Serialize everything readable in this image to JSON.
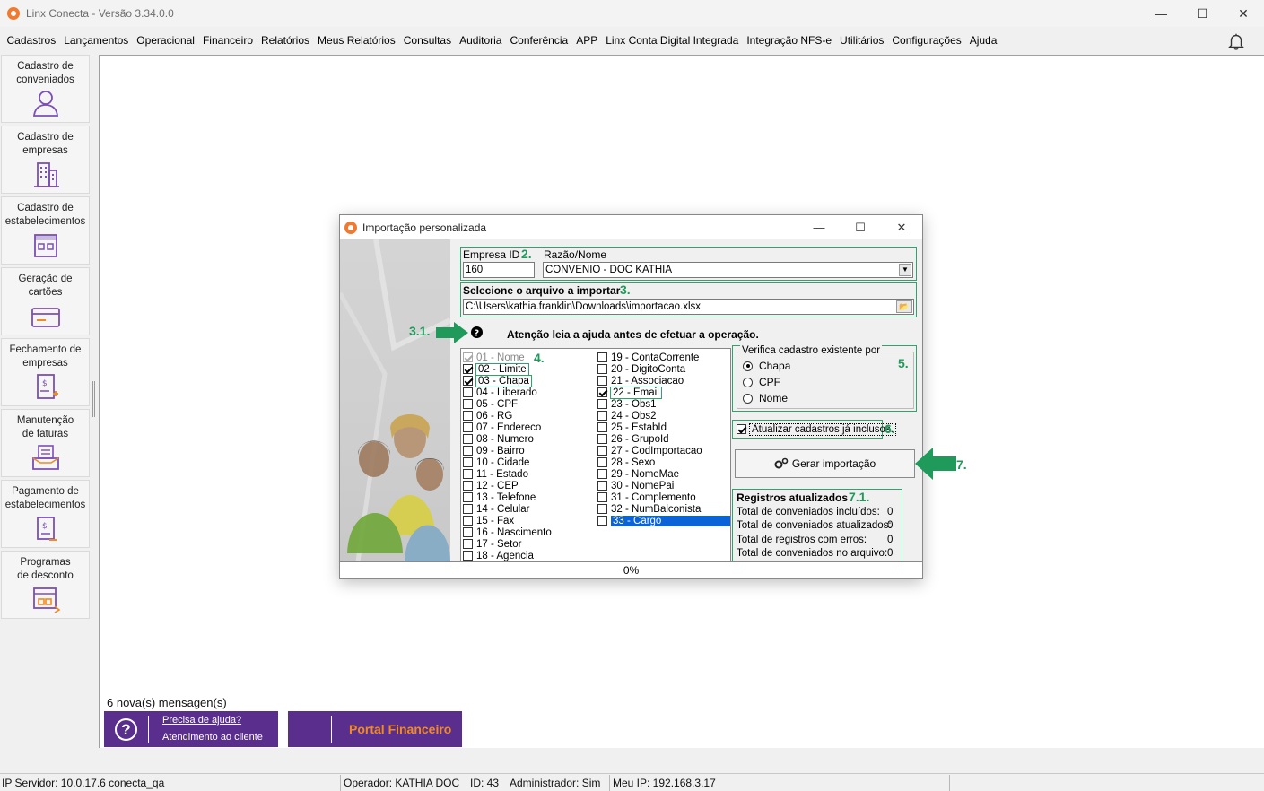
{
  "app": {
    "title": "Linx Conecta - Versão 3.34.0.0"
  },
  "window_controls": {
    "minimize": "—",
    "maximize": "☐",
    "close": "✕"
  },
  "menu": [
    "Cadastros",
    "Lançamentos",
    "Operacional",
    "Financeiro",
    "Relatórios",
    "Meus Relatórios",
    "Consultas",
    "Auditoria",
    "Conferência",
    "APP",
    "Linx Conta Digital Integrada",
    "Integração NFS-e",
    "Utilitários",
    "Configurações",
    "Ajuda"
  ],
  "sidebar": [
    {
      "label": "Cadastro de conveniados",
      "icon": "person-icon"
    },
    {
      "label": "Cadastro de empresas",
      "icon": "building-icon"
    },
    {
      "label": "Cadastro de estabelecimentos",
      "icon": "store-icon"
    },
    {
      "label": "Geração de cartões",
      "icon": "card-icon"
    },
    {
      "label": "Fechamento de empresas",
      "icon": "invoice-icon"
    },
    {
      "label": "Manutenção de faturas",
      "icon": "inbox-icon"
    },
    {
      "label": "Pagamento de estabelecimentos",
      "icon": "payment-icon"
    },
    {
      "label": "Programas de desconto",
      "icon": "discount-icon"
    }
  ],
  "messages": "6 nova(s) mensagen(s)",
  "help": {
    "link": "Precisa de ajuda?",
    "subtitle": "Atendimento ao cliente",
    "icon": "?"
  },
  "portal": {
    "label": "Portal Financeiro"
  },
  "status": {
    "server": "IP Servidor: 10.0.17.6 conecta_qa",
    "operator": "Operador: KATHIA DOC",
    "id": "ID: 43",
    "admin": "Administrador: Sim",
    "my_ip": "Meu IP: 192.168.3.17"
  },
  "dialog": {
    "title": "Importação personalizada",
    "empresa_label": "Empresa ID",
    "empresa_id": "160",
    "razao_label": "Razão/Nome",
    "razao_value": "CONVENIO -  DOC KATHIA",
    "file_label": "Selecione o arquivo a importar",
    "file_path": "C:\\Users\\kathia.franklin\\Downloads\\importacao.xlsx",
    "warning": "Atenção leia a ajuda antes de efetuar a operação.",
    "annotations": {
      "a2": "2.",
      "a3": "3.",
      "a31": "3.1.",
      "a4": "4.",
      "a5": "5.",
      "a6": "6.",
      "a7": "7.",
      "a71": "7.1."
    },
    "fields_col1": [
      {
        "label": "01 - Nome",
        "checked": true,
        "disabled": true
      },
      {
        "label": "02 - Limite",
        "checked": true
      },
      {
        "label": "03 - Chapa",
        "checked": true
      },
      {
        "label": "04 - Liberado",
        "checked": false
      },
      {
        "label": "05 - CPF",
        "checked": false
      },
      {
        "label": "06 - RG",
        "checked": false
      },
      {
        "label": "07 - Endereco",
        "checked": false
      },
      {
        "label": "08 - Numero",
        "checked": false
      },
      {
        "label": "09 - Bairro",
        "checked": false
      },
      {
        "label": "10 - Cidade",
        "checked": false
      },
      {
        "label": "11 - Estado",
        "checked": false
      },
      {
        "label": "12 - CEP",
        "checked": false
      },
      {
        "label": "13 - Telefone",
        "checked": false
      },
      {
        "label": "14 - Celular",
        "checked": false
      },
      {
        "label": "15 - Fax",
        "checked": false
      },
      {
        "label": "16 - Nascimento",
        "checked": false
      },
      {
        "label": "17 - Setor",
        "checked": false
      },
      {
        "label": "18 - Agencia",
        "checked": false
      }
    ],
    "fields_col2": [
      {
        "label": "19 - ContaCorrente",
        "checked": false
      },
      {
        "label": "20 - DigitoConta",
        "checked": false
      },
      {
        "label": "21 - Associacao",
        "checked": false
      },
      {
        "label": "22 - Email",
        "checked": true
      },
      {
        "label": "23 - Obs1",
        "checked": false
      },
      {
        "label": "24 - Obs2",
        "checked": false
      },
      {
        "label": "25 - EstabId",
        "checked": false
      },
      {
        "label": "26 - GrupoId",
        "checked": false
      },
      {
        "label": "27 - CodImportacao",
        "checked": false
      },
      {
        "label": "28 - Sexo",
        "checked": false
      },
      {
        "label": "29 - NomeMae",
        "checked": false
      },
      {
        "label": "30 - NomePai",
        "checked": false
      },
      {
        "label": "31 - Complemento",
        "checked": false
      },
      {
        "label": "32 - NumBalconista",
        "checked": false
      },
      {
        "label": "33 - Cargo",
        "checked": false,
        "selected": true
      }
    ],
    "verify_label": "Verifica cadastro existente por",
    "verify_options": [
      "Chapa",
      "CPF",
      "Nome"
    ],
    "verify_selected": "Chapa",
    "update_label": "Atualizar cadastros já inclusos.",
    "generate_label": "Gerar importação",
    "stats_title": "Registros atualizados",
    "stats": [
      {
        "label": "Total de conveniados incluídos:",
        "value": "0"
      },
      {
        "label": "Total de conveniados atualizados:",
        "value": "0"
      },
      {
        "label": "Total de registros com erros:",
        "value": "0"
      },
      {
        "label": "Total de conveniados no arquivo:",
        "value": "0"
      }
    ],
    "progress": "0%"
  },
  "colors": {
    "accent_green": "#2fa36b",
    "brand_purple": "#5a2e8c",
    "brand_orange": "#f08a24",
    "selection_blue": "#0a64d8"
  }
}
